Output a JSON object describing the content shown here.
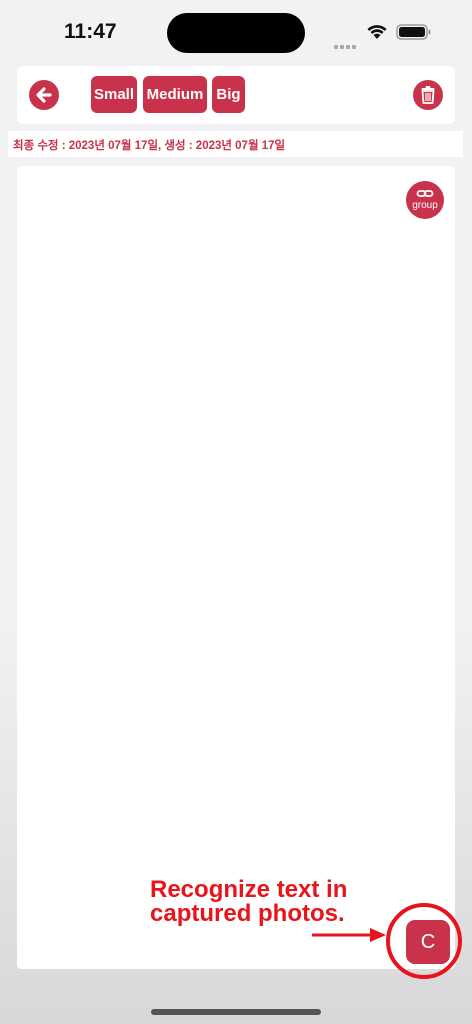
{
  "status_bar": {
    "time": "11:47"
  },
  "toolbar": {
    "size_small": "Small",
    "size_medium": "Medium",
    "size_big": "Big"
  },
  "meta": {
    "text": "최종 수정 : 2023년 07월 17일, 생성 : 2023년 07월 17일"
  },
  "canvas": {
    "group_label": "group"
  },
  "annotation": {
    "line1": "Recognize text in",
    "line2": "captured photos."
  },
  "capture_button": {
    "label": "C"
  },
  "colors": {
    "accent": "#c8324a",
    "annotation": "#e8141b"
  },
  "icons": [
    "back-arrow-icon",
    "trash-icon",
    "link-icon",
    "wifi-icon",
    "battery-icon"
  ]
}
